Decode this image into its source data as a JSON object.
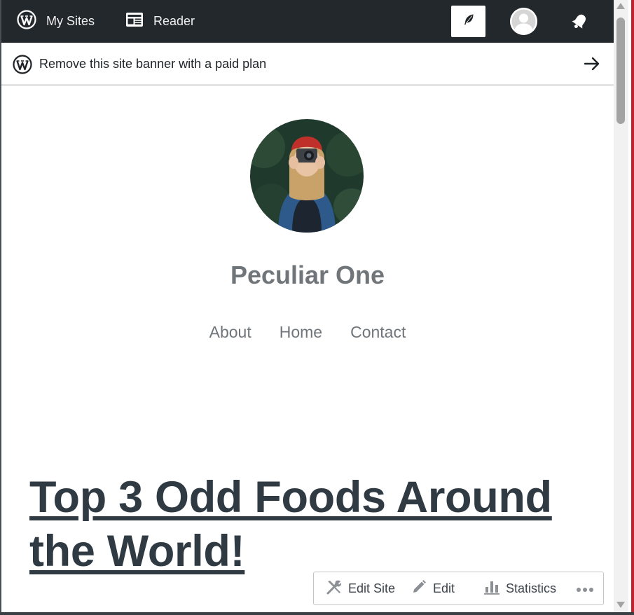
{
  "admin_bar": {
    "my_sites_label": "My Sites",
    "reader_label": "Reader",
    "colors": {
      "background": "#23282d",
      "text": "#f0f0f1"
    }
  },
  "banner": {
    "text": "Remove this site banner with a paid plan"
  },
  "site": {
    "title": "Peculiar One",
    "nav": [
      "About",
      "Home",
      "Contact"
    ]
  },
  "post": {
    "title_line1": "Top 3 Odd Foods Around",
    "title_line2": "the World!"
  },
  "toolbar": {
    "edit_site_label": "Edit Site",
    "edit_label": "Edit",
    "statistics_label": "Statistics",
    "accent_color": "#8c8f94"
  }
}
